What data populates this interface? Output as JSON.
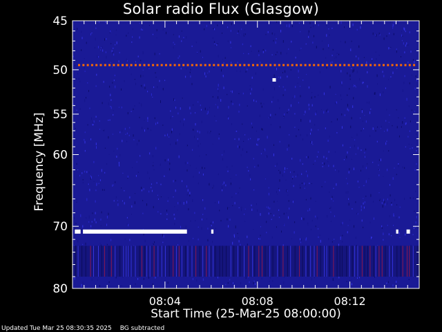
{
  "chart_data": {
    "type": "heatmap",
    "title": "Solar radio Flux (Glasgow)",
    "xlabel": "Start Time (25-Mar-25 08:00:00)",
    "ylabel": "Frequency [MHz]",
    "x_range_minutes": [
      0,
      15
    ],
    "x_ticks": [
      {
        "value": 4,
        "label": "08:04"
      },
      {
        "value": 8,
        "label": "08:08"
      },
      {
        "value": 12,
        "label": "08:12"
      }
    ],
    "y_range_mhz": [
      45,
      80
    ],
    "y_ticks": [
      {
        "value": 45,
        "label": "45"
      },
      {
        "value": 50,
        "label": "50"
      },
      {
        "value": 55,
        "label": "55"
      },
      {
        "value": 60,
        "label": "60"
      },
      {
        "value": 70,
        "label": "70"
      },
      {
        "value": 80,
        "label": "80"
      }
    ],
    "y_scale": "log",
    "background_color": "#1a1a96",
    "interference_line": {
      "frequency_mhz": 49.5,
      "color": "#ff6a00"
    },
    "saturated_segments": [
      {
        "freq_mhz": 70.8,
        "start_min": 0.1,
        "end_min": 0.35
      },
      {
        "freq_mhz": 70.8,
        "start_min": 0.45,
        "end_min": 4.95
      },
      {
        "freq_mhz": 70.8,
        "start_min": 6.0,
        "end_min": 6.1
      },
      {
        "freq_mhz": 70.8,
        "start_min": 14.0,
        "end_min": 14.1
      },
      {
        "freq_mhz": 70.8,
        "start_min": 14.45,
        "end_min": 14.6
      },
      {
        "freq_mhz": 51.1,
        "start_min": 8.65,
        "end_min": 8.8
      }
    ],
    "low_band_mhz": [
      73,
      78
    ]
  },
  "footer": {
    "updated": "Updated Tue Mar 25 08:30:35 2025",
    "note": "BG subtracted"
  }
}
